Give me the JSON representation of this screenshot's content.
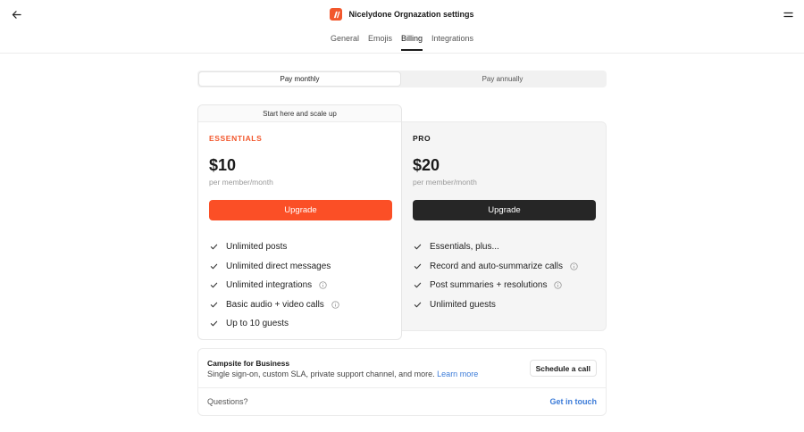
{
  "header": {
    "title": "Nicelydone Orgnazation settings",
    "brand_color": "#f2572c",
    "tabs": [
      {
        "label": "General",
        "active": false
      },
      {
        "label": "Emojis",
        "active": false
      },
      {
        "label": "Billing",
        "active": true
      },
      {
        "label": "Integrations",
        "active": false
      }
    ]
  },
  "billing_toggle": {
    "options": [
      "Pay monthly",
      "Pay annually"
    ],
    "selected": "Pay monthly"
  },
  "plans": [
    {
      "banner": "Start here and scale up",
      "name": "ESSENTIALS",
      "price": "$10",
      "period": "per member/month",
      "cta": "Upgrade",
      "accent": "#fb4f26",
      "features": [
        {
          "text": "Unlimited posts",
          "info": false
        },
        {
          "text": "Unlimited direct messages",
          "info": false
        },
        {
          "text": "Unlimited integrations",
          "info": true
        },
        {
          "text": "Basic audio + video calls",
          "info": true
        },
        {
          "text": "Up to 10 guests",
          "info": false
        }
      ]
    },
    {
      "name": "PRO",
      "price": "$20",
      "period": "per member/month",
      "cta": "Upgrade",
      "accent": "#262626",
      "features": [
        {
          "text": "Essentials, plus...",
          "info": false
        },
        {
          "text": "Record and auto-summarize calls",
          "info": true
        },
        {
          "text": "Post summaries + resolutions",
          "info": true
        },
        {
          "text": "Unlimited guests",
          "info": false
        }
      ]
    }
  ],
  "business": {
    "title": "Campsite for Business",
    "description": "Single sign-on, custom SLA, private support channel, and more.",
    "learn_more": "Learn more",
    "cta": "Schedule a call",
    "questions": "Questions?",
    "contact": "Get in touch",
    "link_color": "#3b7bd8"
  },
  "icons": {
    "back": "arrow-left-icon",
    "menu": "menu-icon",
    "check": "check-icon",
    "info": "info-icon"
  }
}
